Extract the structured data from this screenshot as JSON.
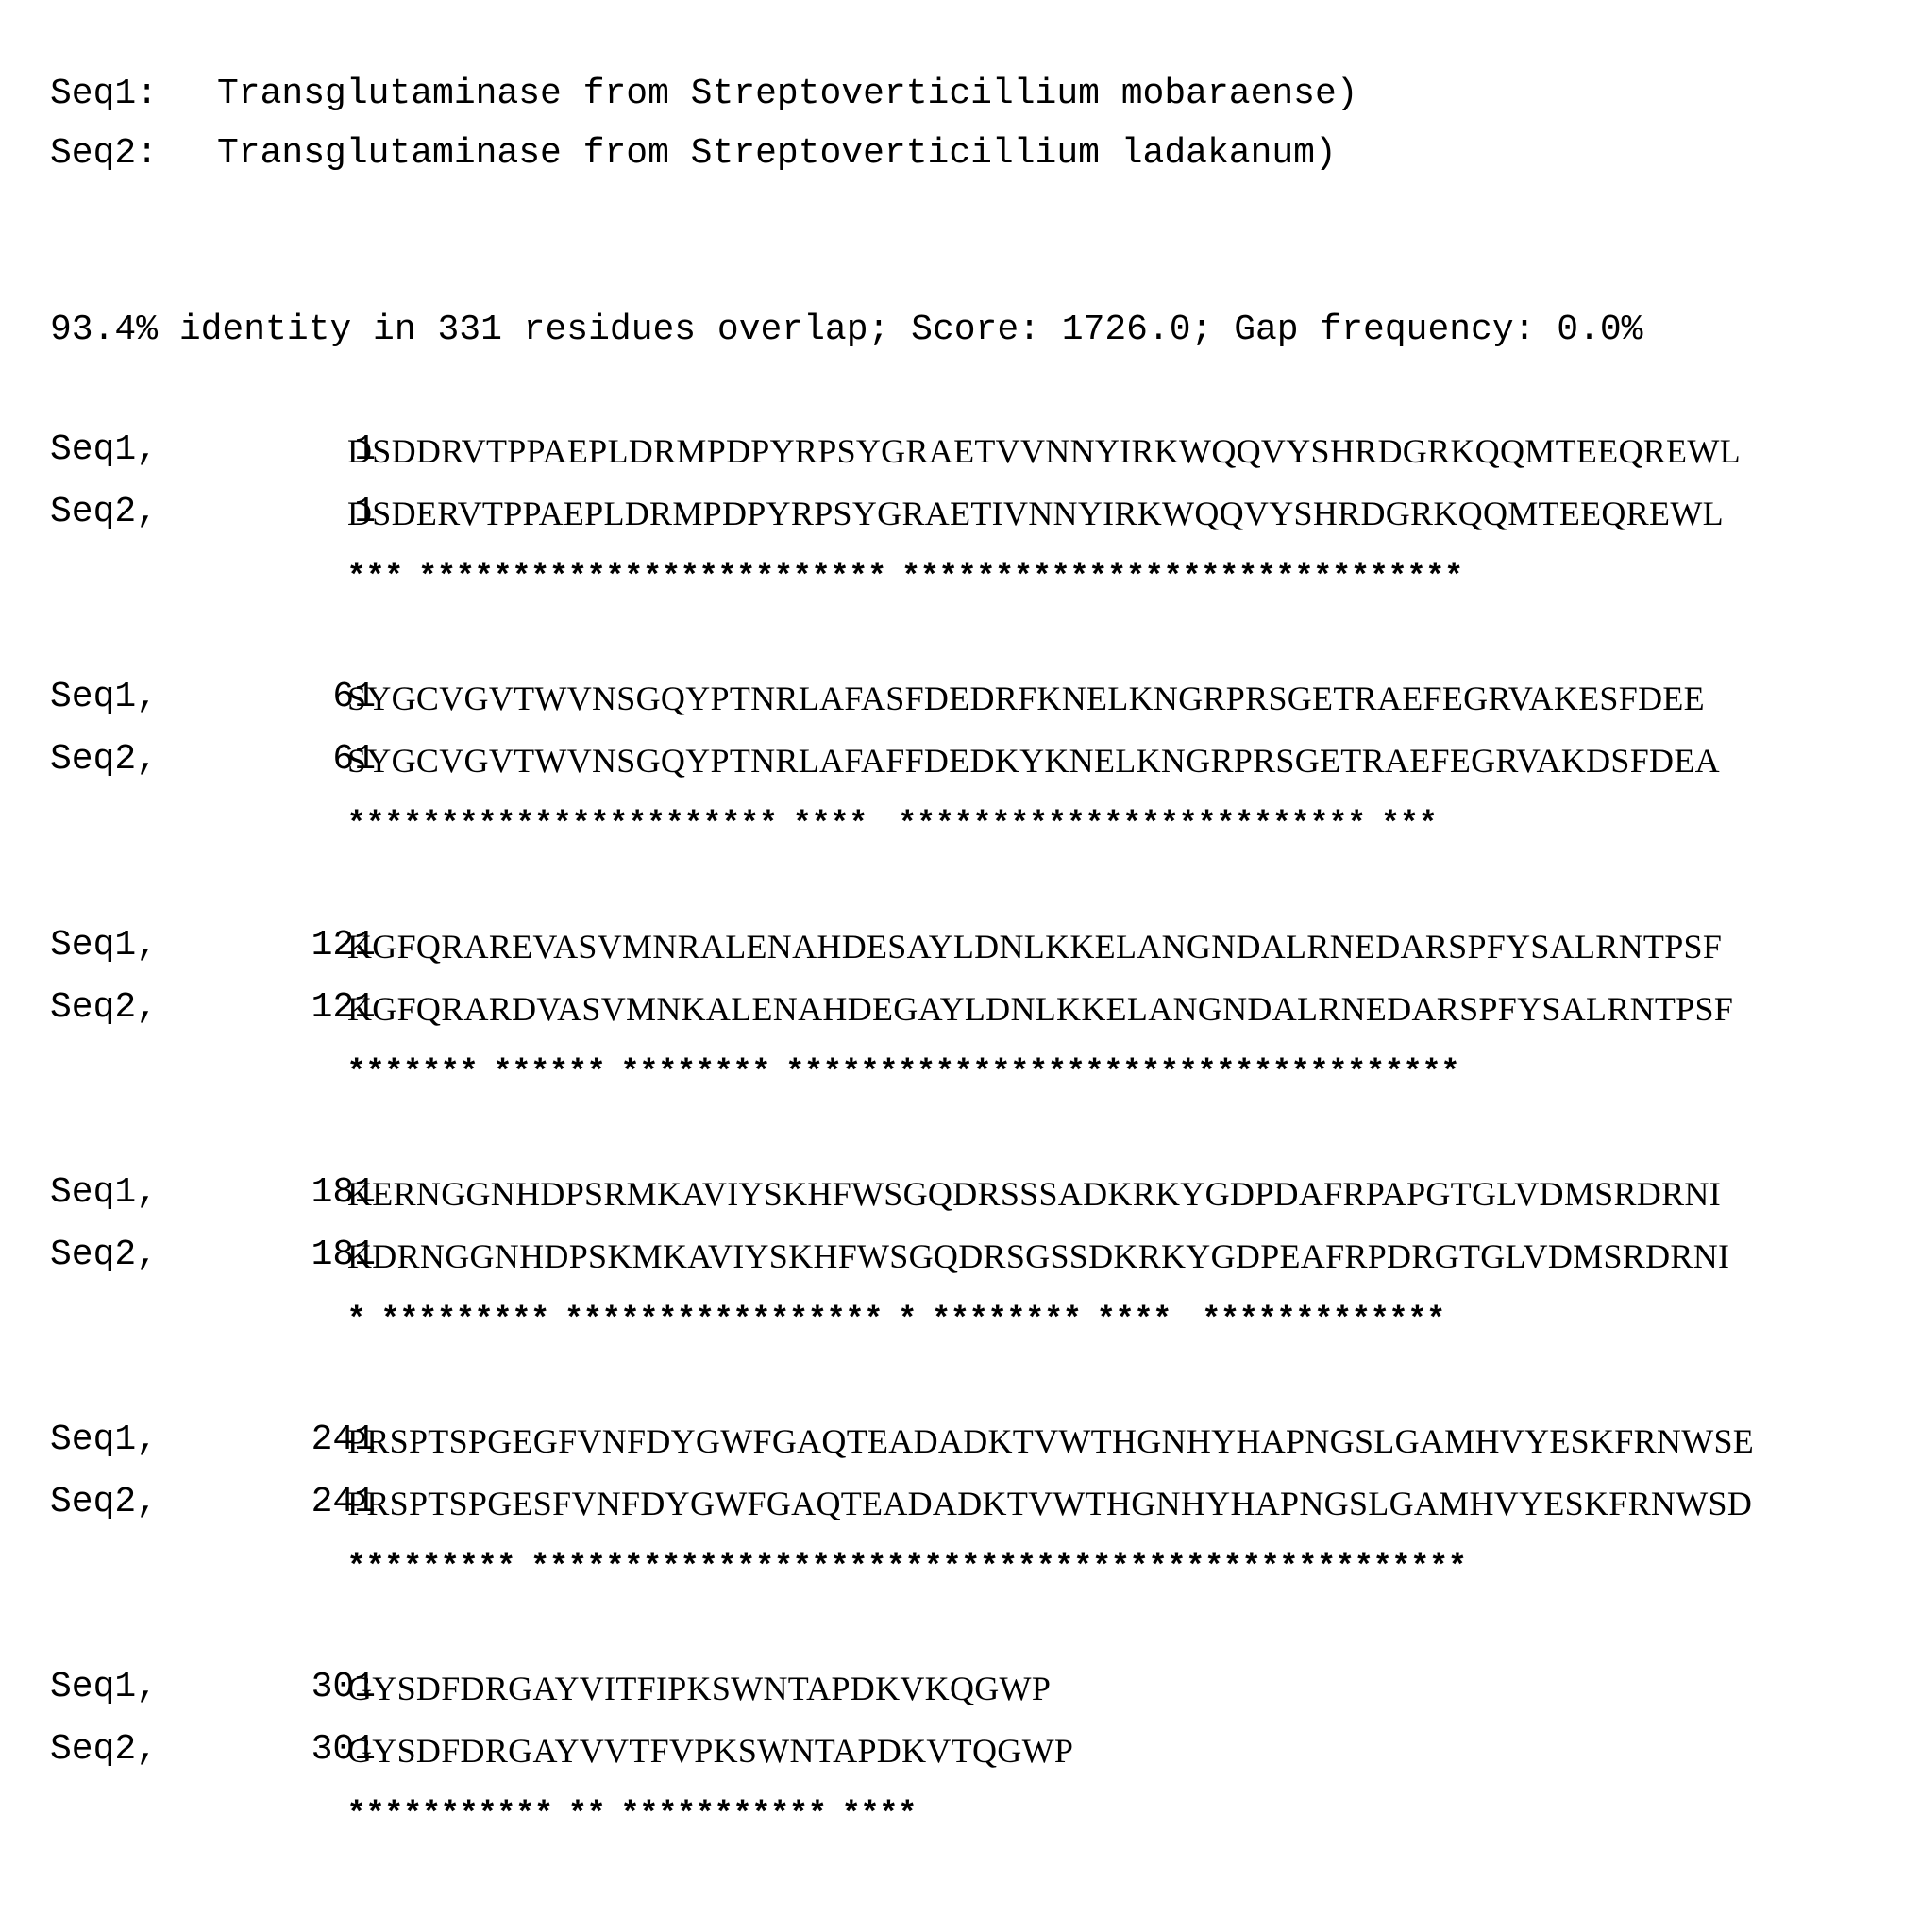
{
  "header": {
    "seq1": {
      "label": "Seq1:",
      "description": "Transglutaminase from Streptoverticillium mobaraense)"
    },
    "seq2": {
      "label": "Seq2:",
      "description": "Transglutaminase from Streptoverticillium ladakanum)"
    }
  },
  "summary": "93.4% identity in 331 residues overlap; Score: 1726.0; Gap frequency: 0.0%",
  "alignment": [
    {
      "seq1_name": "Seq1,",
      "seq1_start": "1",
      "seq1": "DSDDRVTPPAEPLDRMPDPYRPSYGRAETVVNNYIRKWQQVYSHRDGRKQQMTEEQREWL",
      "seq2_name": "Seq2,",
      "seq2_start": "1",
      "seq2": "DSDERVTPPAEPLDRMPDPYRPSYGRAETIVNNYIRKWQQVYSHRDGRKQQMTEEQREWL",
      "consensus": "*** ************************* ******************************"
    },
    {
      "seq1_name": "Seq1,",
      "seq1_start": "61",
      "seq1": "SYGCVGVTWVNSGQYPTNRLAFASFDEDRFKNELKNGRPRSGETRAEFEGRVAKESFDEE",
      "seq2_name": "Seq2,",
      "seq2_start": "61",
      "seq2": "SYGCVGVTWVNSGQYPTNRLAFAFFDEDKYKNELKNGRPRSGETRAEFEGRVAKDSFDEA",
      "consensus": "*********************** ****  ************************* *** "
    },
    {
      "seq1_name": "Seq1,",
      "seq1_start": "121",
      "seq1": "KGFQRAREVASVMNRALENAHDESAYLDNLKKELANGNDALRNEDARSPFYSALRNTPSF",
      "seq2_name": "Seq2,",
      "seq2_start": "121",
      "seq2": "KGFQRARDVASVMNKALENAHDEGAYLDNLKKELANGNDALRNEDARSPFYSALRNTPSF",
      "consensus": "******* ****** ******** ************************************"
    },
    {
      "seq1_name": "Seq1,",
      "seq1_start": "181",
      "seq1": "KERNGGNHDPSRMKAVIYSKHFWSGQDRSSSADKRKYGDPDAFRPAPGTGLVDMSRDRNI",
      "seq2_name": "Seq2,",
      "seq2_start": "181",
      "seq2": "KDRNGGNHDPSKMKAVIYSKHFWSGQDRSGSSDKRKYGDPEAFRPDRGTGLVDMSRDRNI",
      "consensus": "* ********* ***************** * ******** ****  *************"
    },
    {
      "seq1_name": "Seq1,",
      "seq1_start": "241",
      "seq1": "PRSPTSPGEGFVNFDYGWFGAQTEADADKTVWTHGNHYHAPNGSLGAMHVYESKFRNWSE",
      "seq2_name": "Seq2,",
      "seq2_start": "241",
      "seq2": "PRSPTSPGESFVNFDYGWFGAQTEADADKTVWTHGNHYHAPNGSLGAMHVYESKFRNWSD",
      "consensus": "********* ************************************************** "
    },
    {
      "seq1_name": "Seq1,",
      "seq1_start": "301",
      "seq1": "GYSDFDRGAYVITFIPKSWNTAPDKVKQGWP",
      "seq2_name": "Seq2,",
      "seq2_start": "301",
      "seq2": "GYSDFDRGAYVVTFVPKSWNTAPDKVTQGWP",
      "consensus": "*********** ** *********** ****"
    }
  ]
}
